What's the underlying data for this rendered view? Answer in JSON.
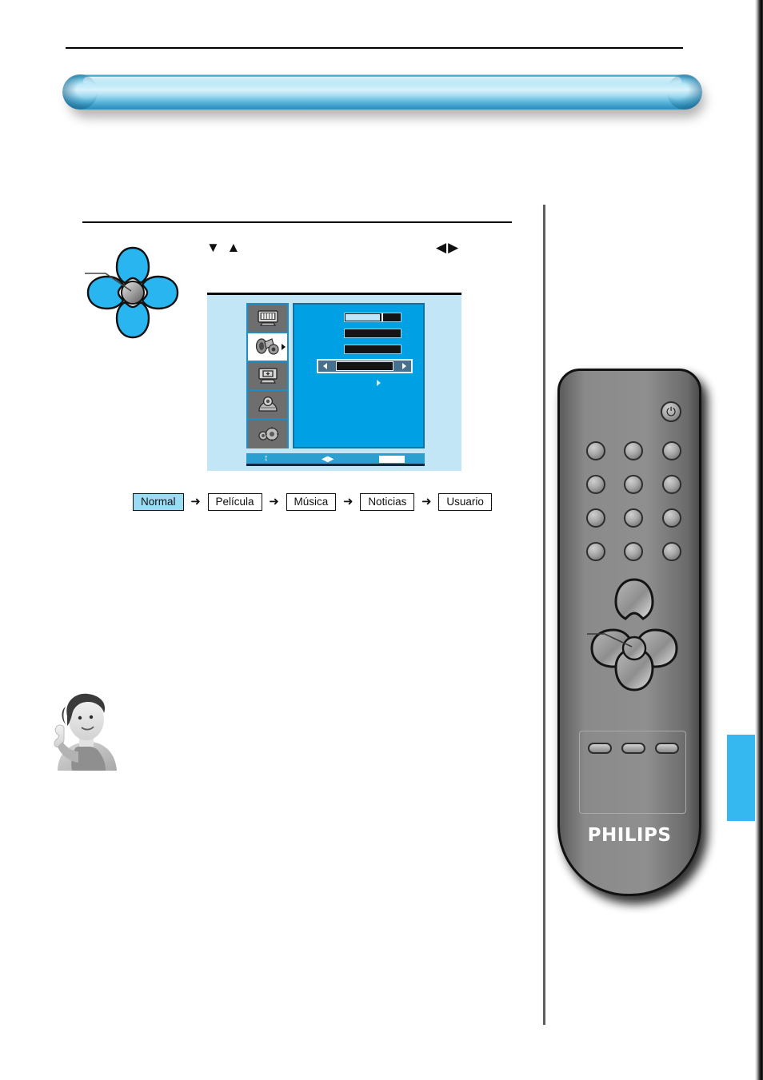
{
  "header": {
    "title": ""
  },
  "section": {
    "title": "",
    "cursor_updown_glyph": "▼ ▲",
    "cursor_leftright_glyph": "◀▶",
    "cursor_updown_label": "",
    "cursor_leftright_label": ""
  },
  "osd": {
    "icons": [
      {
        "name": "picture-icon",
        "label": ""
      },
      {
        "name": "sound-icon",
        "label": "",
        "selected": true
      },
      {
        "name": "picture-format-icon",
        "label": ""
      },
      {
        "name": "smart-feature-icon",
        "label": ""
      },
      {
        "name": "install-settings-icon",
        "label": ""
      }
    ],
    "rows": [
      {
        "type": "slider",
        "label": "",
        "value": ""
      },
      {
        "type": "bar",
        "label": "",
        "value": ""
      },
      {
        "type": "bar",
        "label": "",
        "value": ""
      },
      {
        "type": "selector",
        "label": "",
        "value": ""
      },
      {
        "type": "submenu",
        "label": "",
        "value": ""
      }
    ],
    "status_bar": {
      "updown_glyph": "↕",
      "leftright_glyph": "◀▶",
      "button_label": ""
    }
  },
  "chain": {
    "arrow_glyph": "➜",
    "items": [
      {
        "label": "Normal",
        "active": true
      },
      {
        "label": "Película",
        "active": false
      },
      {
        "label": "Música",
        "active": false
      },
      {
        "label": "Noticias",
        "active": false
      },
      {
        "label": "Usuario",
        "active": false
      }
    ]
  },
  "body": {
    "paragraph_1": "",
    "paragraph_2": "",
    "tip_text": ""
  },
  "remote": {
    "brand": "PHILIPS",
    "power_glyph": "⏻",
    "caption": "",
    "number_buttons": [
      "",
      "",
      "",
      "",
      "",
      "",
      "",
      "",
      "",
      "",
      "",
      ""
    ],
    "function_buttons": [
      "",
      "",
      ""
    ],
    "dpad": {
      "up": "",
      "down": "",
      "left": "",
      "right": "",
      "ok": ""
    }
  },
  "page": {
    "number": "",
    "tab_color": "#35b8ef"
  },
  "colors": {
    "accent_blue": "#35b8ef",
    "osd_blue": "#00a0e4",
    "osd_background": "#c3e6f7",
    "chain_highlight": "#9bdcf5",
    "dpad_blue": "#29b6f0",
    "remote_gray": "#8a8a8a"
  }
}
